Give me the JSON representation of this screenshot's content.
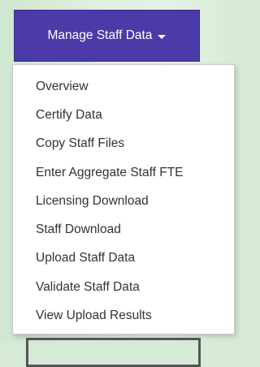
{
  "menu_button": {
    "label": "Manage Staff Data"
  },
  "dropdown": {
    "items": [
      {
        "label": "Overview"
      },
      {
        "label": "Certify Data"
      },
      {
        "label": "Copy Staff Files"
      },
      {
        "label": "Enter Aggregate Staff FTE"
      },
      {
        "label": "Licensing Download"
      },
      {
        "label": "Staff Download"
      },
      {
        "label": "Upload Staff Data"
      },
      {
        "label": "Validate Staff Data"
      },
      {
        "label": "View Upload Results"
      }
    ],
    "highlighted_item": "Validate Staff Data"
  },
  "colors": {
    "button_bg": "#4b3aa8",
    "background": "#d6ead6",
    "highlight_border": "#555555"
  }
}
